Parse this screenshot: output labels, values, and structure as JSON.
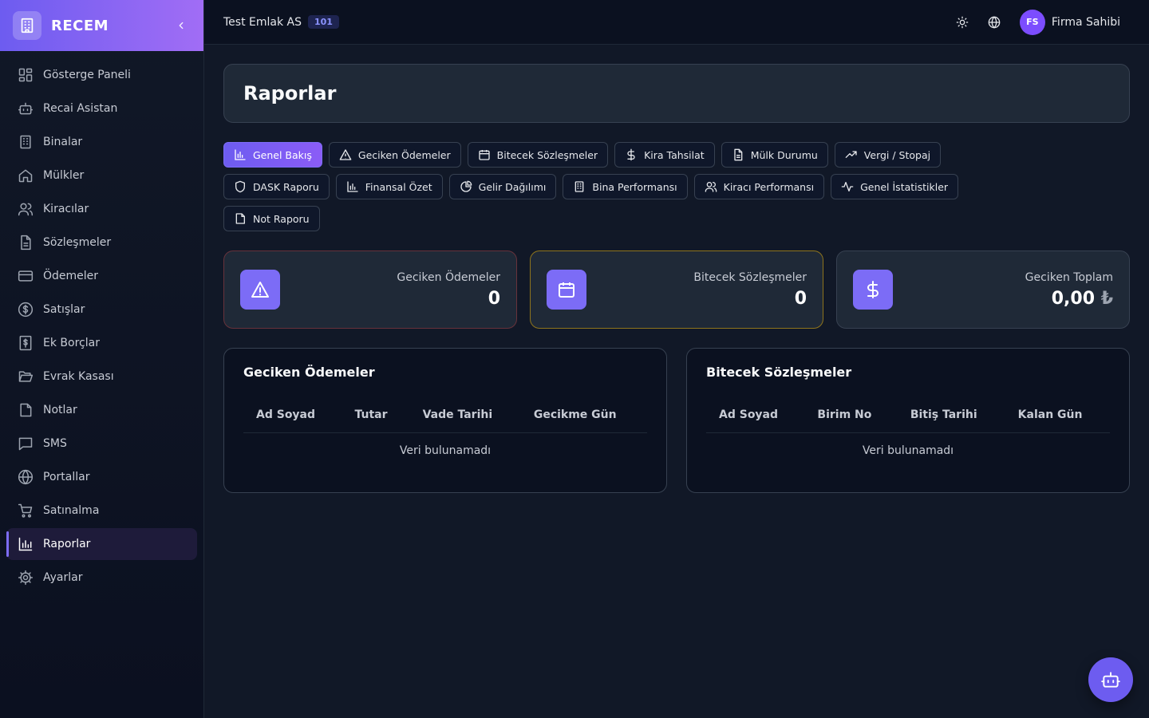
{
  "brand": {
    "name": "RECEM"
  },
  "sidebar": {
    "items": [
      {
        "label": "Gösterge Paneli",
        "icon": "grid-icon"
      },
      {
        "label": "Recai Asistan",
        "icon": "robot-icon"
      },
      {
        "label": "Binalar",
        "icon": "building-icon"
      },
      {
        "label": "Mülkler",
        "icon": "home-icon"
      },
      {
        "label": "Kiracılar",
        "icon": "users-icon"
      },
      {
        "label": "Sözleşmeler",
        "icon": "document-icon"
      },
      {
        "label": "Ödemeler",
        "icon": "credit-card-icon"
      },
      {
        "label": "Satışlar",
        "icon": "dollar-circle-icon"
      },
      {
        "label": "Ek Borçlar",
        "icon": "receipt-icon"
      },
      {
        "label": "Evrak Kasası",
        "icon": "folder-open-icon"
      },
      {
        "label": "Notlar",
        "icon": "sticky-note-icon"
      },
      {
        "label": "SMS",
        "icon": "message-icon"
      },
      {
        "label": "Portallar",
        "icon": "globe-icon"
      },
      {
        "label": "Satınalma",
        "icon": "cart-icon"
      },
      {
        "label": "Raporlar",
        "icon": "bar-chart-icon",
        "active": true
      },
      {
        "label": "Ayarlar",
        "icon": "gear-icon"
      }
    ]
  },
  "topbar": {
    "company": "Test Emlak AS",
    "company_badge": "101",
    "user_initials": "FS",
    "user_name": "Firma Sahibi"
  },
  "page": {
    "title": "Raporlar"
  },
  "tabs": [
    {
      "label": "Genel Bakış",
      "icon": "bar-chart-icon",
      "active": true
    },
    {
      "label": "Geciken Ödemeler",
      "icon": "alert-triangle-icon"
    },
    {
      "label": "Bitecek Sözleşmeler",
      "icon": "calendar-icon"
    },
    {
      "label": "Kira Tahsilat",
      "icon": "dollar-icon"
    },
    {
      "label": "Mülk Durumu",
      "icon": "document-icon"
    },
    {
      "label": "Vergi / Stopaj",
      "icon": "trending-up-icon"
    },
    {
      "label": "DASK Raporu",
      "icon": "shield-icon"
    },
    {
      "label": "Finansal Özet",
      "icon": "bar-chart-icon"
    },
    {
      "label": "Gelir Dağılımı",
      "icon": "pie-chart-icon"
    },
    {
      "label": "Bina Performansı",
      "icon": "building-icon"
    },
    {
      "label": "Kiracı Performansı",
      "icon": "users-icon"
    },
    {
      "label": "Genel İstatistikler",
      "icon": "activity-icon"
    },
    {
      "label": "Not Raporu",
      "icon": "sticky-note-icon"
    }
  ],
  "stats": [
    {
      "label": "Geciken Ödemeler",
      "value": "0",
      "icon": "alert-triangle-icon"
    },
    {
      "label": "Bitecek Sözleşmeler",
      "value": "0",
      "icon": "calendar-icon"
    },
    {
      "label": "Geciken Toplam",
      "value": "0,00",
      "currency": "₺",
      "icon": "dollar-icon"
    }
  ],
  "panels": {
    "overdue": {
      "title": "Geciken Ödemeler",
      "columns": [
        "Ad Soyad",
        "Tutar",
        "Vade Tarihi",
        "Gecikme Gün"
      ],
      "empty": "Veri bulunamadı"
    },
    "expiring": {
      "title": "Bitecek Sözleşmeler",
      "columns": [
        "Ad Soyad",
        "Birim No",
        "Bitiş Tarihi",
        "Kalan Gün"
      ],
      "empty": "Veri bulunamadı"
    }
  },
  "colors": {
    "accent": "#7c6cf6",
    "background": "#111827",
    "card": "#1f2937"
  }
}
